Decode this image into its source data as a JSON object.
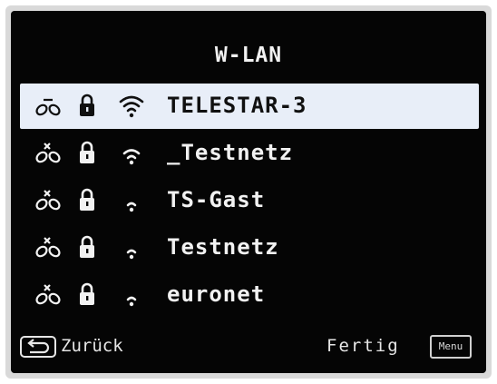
{
  "screen": {
    "title": "W-LAN"
  },
  "networks": [
    {
      "name": "TELESTAR-3",
      "selected": true,
      "signal_bars": 3,
      "locked": true,
      "icons": [
        "link-icon",
        "lock-icon",
        "wifi-signal-icon"
      ]
    },
    {
      "name": "_Testnetz",
      "selected": false,
      "signal_bars": 2,
      "locked": true,
      "icons": [
        "link-broken-icon",
        "lock-icon",
        "wifi-signal-icon"
      ]
    },
    {
      "name": "TS-Gast",
      "selected": false,
      "signal_bars": 1,
      "locked": true,
      "icons": [
        "link-broken-icon",
        "lock-icon",
        "wifi-signal-icon"
      ]
    },
    {
      "name": "Testnetz",
      "selected": false,
      "signal_bars": 1,
      "locked": true,
      "icons": [
        "link-broken-icon",
        "lock-icon",
        "wifi-signal-icon"
      ]
    },
    {
      "name": "euronet",
      "selected": false,
      "signal_bars": 1,
      "locked": true,
      "icons": [
        "link-broken-icon",
        "lock-icon",
        "wifi-signal-icon"
      ]
    }
  ],
  "footer": {
    "back_label": "Zurück",
    "done_label": "Fertig",
    "menu_label": "Menu"
  },
  "colors": {
    "background": "#050505",
    "text": "#f2f2f2",
    "selection": "#e8eef8"
  }
}
